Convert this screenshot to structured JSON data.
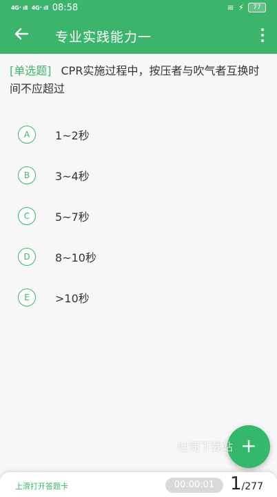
{
  "status": {
    "signal_1": "4G⁺ ıll",
    "signal_2": "4G⁺ ıll",
    "time": "08:58",
    "wifi": "≋",
    "charging": "⚡",
    "battery": "77"
  },
  "appbar": {
    "title": "专业实践能力一",
    "back_icon": "arrow-left",
    "more_icon": "more-vertical"
  },
  "question": {
    "type_label": "[单选题]",
    "text": "CPR实施过程中，按压者与吹气者互换时间不应超过"
  },
  "options": [
    {
      "letter": "A",
      "text": "1~2秒"
    },
    {
      "letter": "B",
      "text": "3~4秒"
    },
    {
      "letter": "C",
      "text": "5~7秒"
    },
    {
      "letter": "D",
      "text": "8~10秒"
    },
    {
      "letter": "E",
      "text": ">10秒"
    }
  ],
  "fab": {
    "icon": "plus",
    "symbol": "+"
  },
  "watermark": "吐司下载站",
  "bottom": {
    "answer_card_label": "上滑打开答题卡",
    "timer": "00:00:01",
    "current": "1",
    "separator": "/",
    "total": "277"
  },
  "colors": {
    "primary": "#3cb46c",
    "background": "#f7f7f7"
  }
}
